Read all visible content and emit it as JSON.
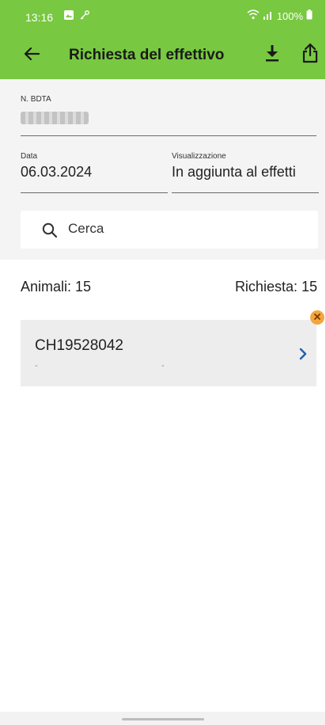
{
  "status_bar": {
    "time": "13:16",
    "battery": "100%",
    "icons": [
      "image-icon",
      "key-icon",
      "wifi-icon",
      "signal-icon",
      "battery-icon"
    ]
  },
  "toolbar": {
    "title": "Richiesta del effettivo",
    "icons": [
      "back-arrow-icon",
      "download-icon",
      "share-icon"
    ]
  },
  "form": {
    "bdta_label": "N. BDTA",
    "bdta_value": "",
    "date_label": "Data",
    "date_value": "06.03.2024",
    "view_label": "Visualizzazione",
    "view_value": "In aggiunta al effetti"
  },
  "search": {
    "placeholder": "Cerca"
  },
  "summary": {
    "animals": "Animali: 15",
    "requests": "Richiesta: 15"
  },
  "list": {
    "items": [
      {
        "id": "CH19528042",
        "sub_left": "-",
        "sub_right": "-"
      }
    ]
  },
  "colors": {
    "header_green": "#78c841",
    "form_bg": "#f4f4f4",
    "card_bg": "#ededed",
    "remove_badge": "#f3a63b",
    "chevron_blue": "#1f5fb0"
  }
}
